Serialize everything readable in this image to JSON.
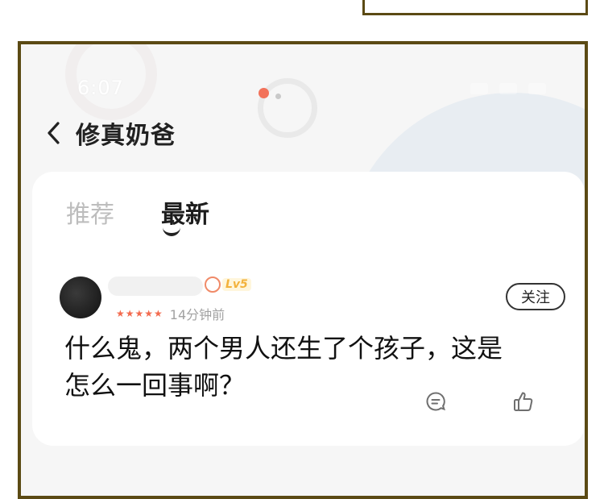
{
  "status_bar": {
    "time": "6:07"
  },
  "header": {
    "title": "修真奶爸"
  },
  "tabs": [
    {
      "label": "推荐",
      "active": false
    },
    {
      "label": "最新",
      "active": true
    }
  ],
  "comment": {
    "level": "Lv5",
    "rating_stars": "★★★★★",
    "time_ago": "14分钟前",
    "follow_label": "关注",
    "text": "什么鬼，两个男人还生了个孩子，这是怎么一回事啊？"
  },
  "colors": {
    "frame_border": "#5b4a14",
    "star": "#f36b4f",
    "loader_accent": "#f2725a"
  }
}
